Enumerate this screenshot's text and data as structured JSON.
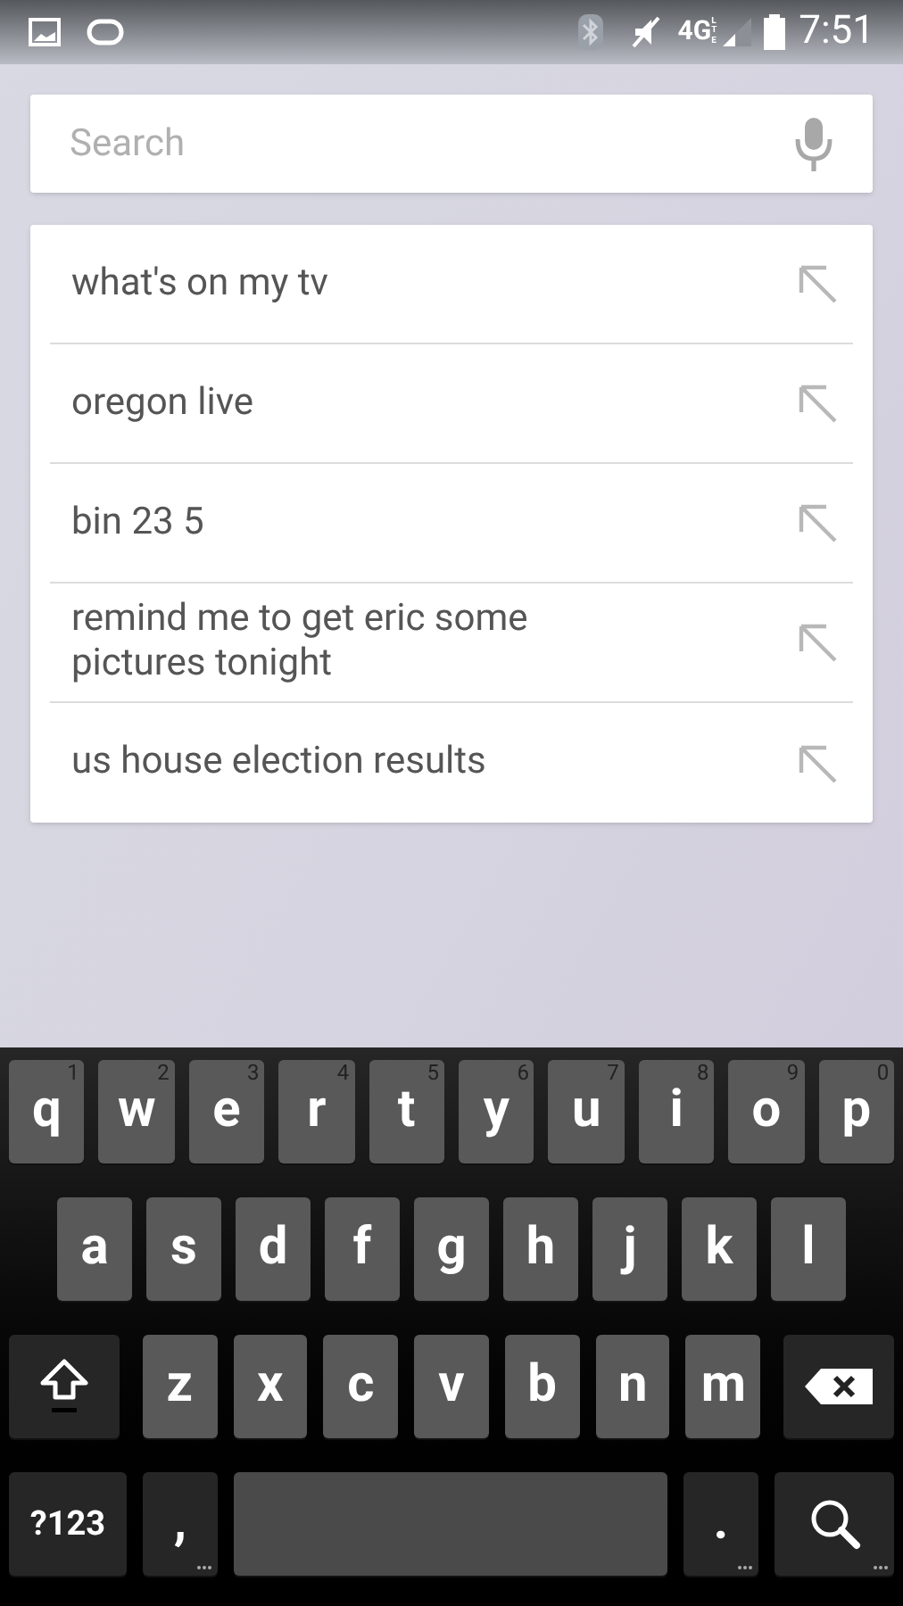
{
  "status_bar": {
    "network": "4G",
    "network_sub": "LTE",
    "time": "7:51"
  },
  "search": {
    "placeholder": "Search"
  },
  "suggestions": [
    {
      "text": "what's on my tv"
    },
    {
      "text": "oregon live"
    },
    {
      "text": "bin 23 5"
    },
    {
      "text": "remind me to get eric some pictures tonight"
    },
    {
      "text": "us house election results"
    }
  ],
  "keyboard": {
    "rows": [
      {
        "keys": [
          {
            "kind": "letter",
            "label": "q",
            "hint": "1"
          },
          {
            "kind": "letter",
            "label": "w",
            "hint": "2"
          },
          {
            "kind": "letter",
            "label": "e",
            "hint": "3"
          },
          {
            "kind": "letter",
            "label": "r",
            "hint": "4"
          },
          {
            "kind": "letter",
            "label": "t",
            "hint": "5"
          },
          {
            "kind": "letter",
            "label": "y",
            "hint": "6"
          },
          {
            "kind": "letter",
            "label": "u",
            "hint": "7"
          },
          {
            "kind": "letter",
            "label": "i",
            "hint": "8"
          },
          {
            "kind": "letter",
            "label": "o",
            "hint": "9"
          },
          {
            "kind": "letter",
            "label": "p",
            "hint": "0"
          }
        ]
      },
      {
        "keys": [
          {
            "kind": "letter",
            "label": "a"
          },
          {
            "kind": "letter",
            "label": "s"
          },
          {
            "kind": "letter",
            "label": "d"
          },
          {
            "kind": "letter",
            "label": "f"
          },
          {
            "kind": "letter",
            "label": "g"
          },
          {
            "kind": "letter",
            "label": "h"
          },
          {
            "kind": "letter",
            "label": "j"
          },
          {
            "kind": "letter",
            "label": "k"
          },
          {
            "kind": "letter",
            "label": "l"
          }
        ]
      },
      {
        "keys": [
          {
            "kind": "shift"
          },
          {
            "kind": "letter",
            "label": "z"
          },
          {
            "kind": "letter",
            "label": "x"
          },
          {
            "kind": "letter",
            "label": "c"
          },
          {
            "kind": "letter",
            "label": "v"
          },
          {
            "kind": "letter",
            "label": "b"
          },
          {
            "kind": "letter",
            "label": "n"
          },
          {
            "kind": "letter",
            "label": "m"
          },
          {
            "kind": "delete"
          }
        ]
      },
      {
        "keys": [
          {
            "kind": "symbols",
            "label": "?123"
          },
          {
            "kind": "punct",
            "label": ",",
            "more": true
          },
          {
            "kind": "space"
          },
          {
            "kind": "punct",
            "label": ".",
            "more": true
          },
          {
            "kind": "search",
            "more": true
          }
        ]
      }
    ]
  }
}
